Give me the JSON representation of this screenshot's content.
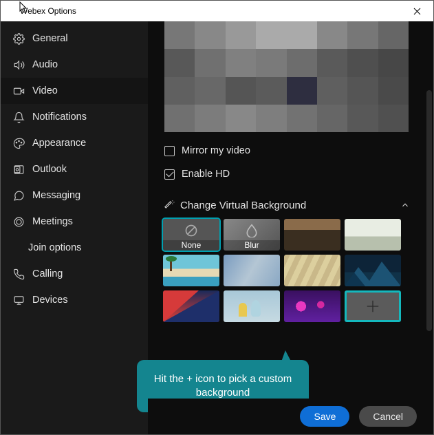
{
  "window": {
    "title": "Webex Options"
  },
  "sidebar": {
    "items": [
      {
        "label": "General"
      },
      {
        "label": "Audio"
      },
      {
        "label": "Video"
      },
      {
        "label": "Notifications"
      },
      {
        "label": "Appearance"
      },
      {
        "label": "Outlook"
      },
      {
        "label": "Messaging"
      },
      {
        "label": "Meetings"
      },
      {
        "label": "Join options"
      },
      {
        "label": "Calling"
      },
      {
        "label": "Devices"
      }
    ]
  },
  "video": {
    "mirror_label": "Mirror my video",
    "hd_label": "Enable HD",
    "section_label": "Change Virtual Background",
    "bg": {
      "none": "None",
      "blur": "Blur"
    }
  },
  "callout": {
    "text": "Hit the + icon to pick a custom background"
  },
  "footer": {
    "save": "Save",
    "cancel": "Cancel"
  }
}
